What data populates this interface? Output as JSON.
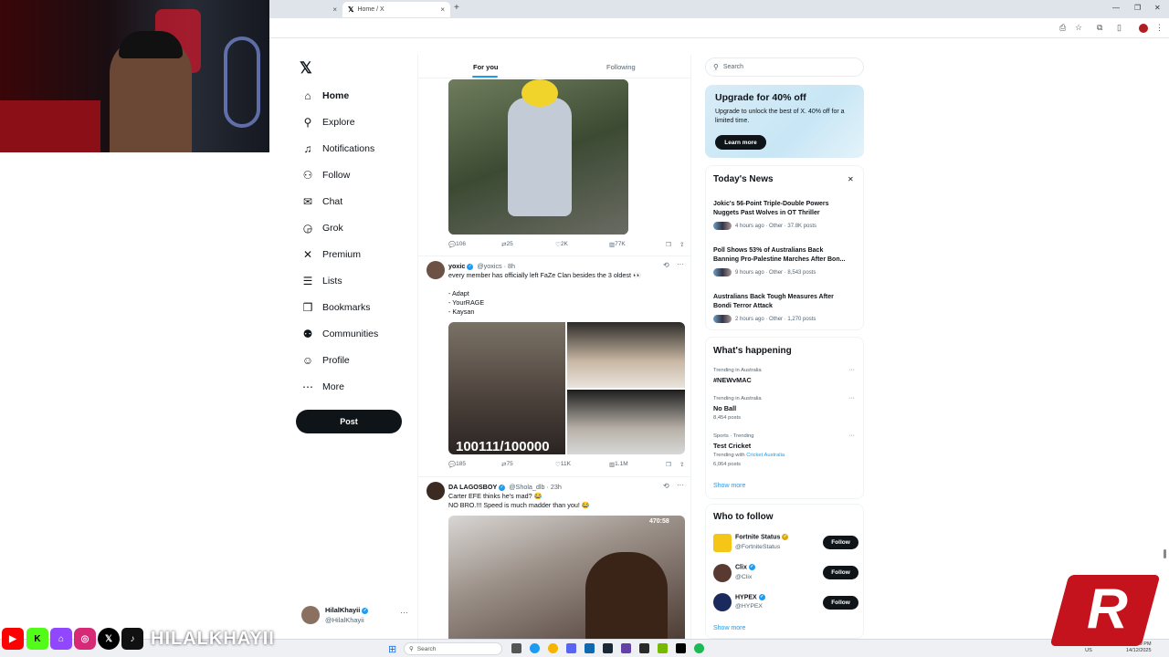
{
  "browser": {
    "tab_active_title": "Home / X",
    "tab_close": "×",
    "new_tab": "+",
    "window_controls": [
      "—",
      "❐",
      "✕"
    ]
  },
  "nav": {
    "items": [
      {
        "label": "Home",
        "icon": "home-icon",
        "glyph": "⌂"
      },
      {
        "label": "Explore",
        "icon": "search-icon",
        "glyph": "⚲"
      },
      {
        "label": "Notifications",
        "icon": "bell-icon",
        "glyph": "♫"
      },
      {
        "label": "Follow",
        "icon": "follow-icon",
        "glyph": "⚇"
      },
      {
        "label": "Chat",
        "icon": "mail-icon",
        "glyph": "✉"
      },
      {
        "label": "Grok",
        "icon": "grok-icon",
        "glyph": "◶"
      },
      {
        "label": "Premium",
        "icon": "x-icon",
        "glyph": "✕"
      },
      {
        "label": "Lists",
        "icon": "list-icon",
        "glyph": "☰"
      },
      {
        "label": "Bookmarks",
        "icon": "bookmark-icon",
        "glyph": "❒"
      },
      {
        "label": "Communities",
        "icon": "communities-icon",
        "glyph": "⚉"
      },
      {
        "label": "Profile",
        "icon": "person-icon",
        "glyph": "☺"
      },
      {
        "label": "More",
        "icon": "more-icon",
        "glyph": "⋯"
      }
    ],
    "post_label": "Post",
    "account": {
      "name": "HilalKhayii",
      "handle": "@HilalKhayii",
      "more": "···"
    }
  },
  "timeline": {
    "tabs": {
      "for_you": "For you",
      "following": "Following"
    },
    "tweet1_actions": {
      "replies": "106",
      "reposts": "25",
      "likes": "2K",
      "views": "77K"
    },
    "tweet2": {
      "name": "yoxic",
      "handle": "@yoxics",
      "time": "· 8h",
      "text": "every member has officially left FaZe Clan besides the 3 oldest 👀\n\n- Adapt\n- YourRAGE\n- Kaysan",
      "image_counter": "100111/100000",
      "actions": {
        "replies": "185",
        "reposts": "75",
        "likes": "11K",
        "views": "1.1M"
      }
    },
    "tweet3": {
      "name": "DA LAGOSBOY",
      "handle": "@Shola_dlb",
      "time": "· 23h",
      "text": "Carter EFE thinks he's mad? 😂\nNO BRO.!!! Speed is much madder than you! 😂",
      "media_count": "470:58"
    }
  },
  "sidebar": {
    "search_placeholder": "Search",
    "promo": {
      "title": "Upgrade for 40% off",
      "text": "Upgrade to unlock the best of X. 40% off for a limited time.",
      "button": "Learn more"
    },
    "news": {
      "title": "Today's News",
      "close": "✕",
      "items": [
        {
          "headline": "Jokic's 56-Point Triple-Double Powers Nuggets Past Wolves in OT Thriller",
          "meta": "4 hours ago · Other · 37.8K posts"
        },
        {
          "headline": "Poll Shows 53% of Australians Back Banning Pro-Palestine Marches After Bon...",
          "meta": "9 hours ago · Other · 8,543 posts"
        },
        {
          "headline": "Australians Back Tough Measures After Bondi Terror Attack",
          "meta": "2 hours ago · Other · 1,270 posts"
        }
      ]
    },
    "happening": {
      "title": "What's happening",
      "trends": [
        {
          "context": "Trending in Australia",
          "name": "#NEWvMAC",
          "posts": "",
          "with": ""
        },
        {
          "context": "Trending in Australia",
          "name": "No Ball",
          "posts": "8,454 posts",
          "with": ""
        },
        {
          "context": "Sports · Trending",
          "name": "Test Cricket",
          "posts": "6,064 posts",
          "with": "Cricket Australia"
        }
      ],
      "trending_with_label": "Trending with",
      "show_more": "Show more"
    },
    "who_to_follow": {
      "title": "Who to follow",
      "accounts": [
        {
          "name": "Fortnite Status",
          "handle": "@FortniteStatus",
          "color": "#f5c518"
        },
        {
          "name": "Clix",
          "handle": "@Clix",
          "color": "#5a3a30"
        },
        {
          "name": "HYPEX",
          "handle": "@HYPEX",
          "color": "#1b2a5c"
        }
      ],
      "follow_label": "Follow",
      "show_more": "Show more"
    }
  },
  "overlay": {
    "channel_handle": "HILALKHAYII",
    "r_logo": "R"
  },
  "taskbar": {
    "search_placeholder": "Search",
    "lang": "ENG\nUS",
    "time": "8:29 PM\n14/12/2025"
  },
  "colors": {
    "accent": "#1d9bf0",
    "text": "#0f1419",
    "muted": "#536471",
    "brand_red": "#c4131c"
  }
}
